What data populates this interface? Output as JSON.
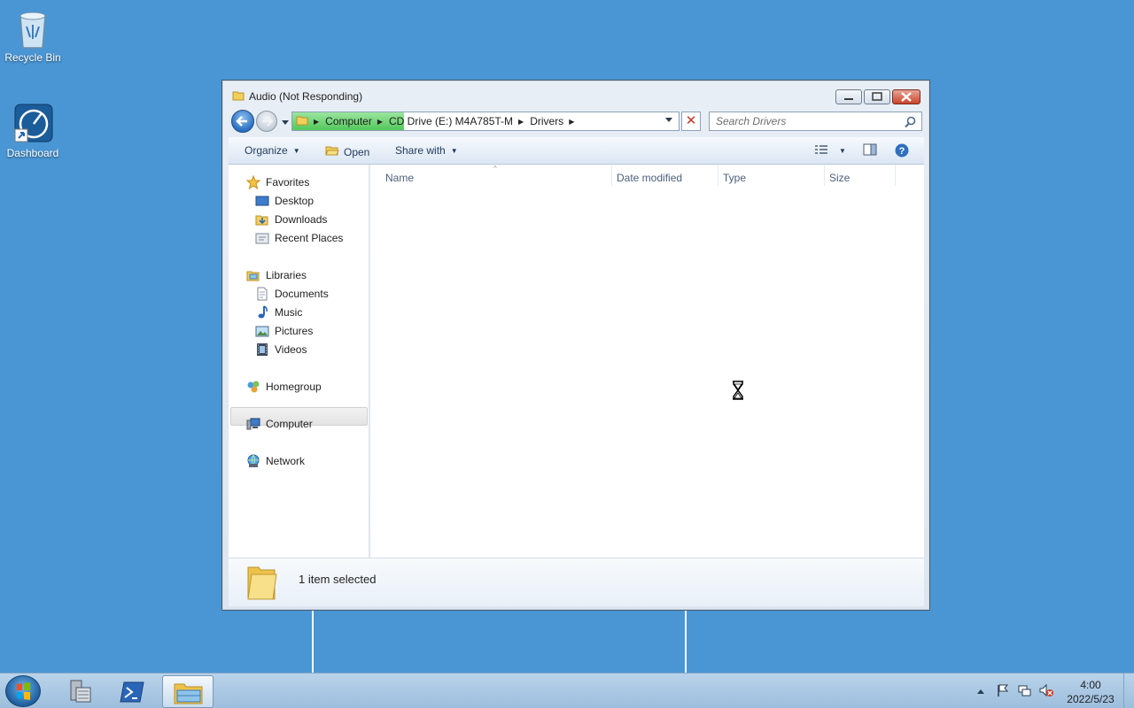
{
  "desktop": {
    "icons": [
      {
        "label": "Recycle Bin"
      },
      {
        "label": "Dashboard"
      }
    ]
  },
  "window": {
    "title": "Audio (Not Responding)",
    "address": {
      "crumbs": [
        "Computer",
        "CD Drive (E:) M4A785T-M",
        "Drivers"
      ],
      "load_progress_pct": 29
    },
    "search": {
      "placeholder": "Search Drivers"
    },
    "command_bar": {
      "organize": "Organize",
      "open": "Open",
      "share_with": "Share with"
    },
    "nav": {
      "favorites": "Favorites",
      "desktop": "Desktop",
      "downloads": "Downloads",
      "recent_places": "Recent Places",
      "libraries": "Libraries",
      "documents": "Documents",
      "music": "Music",
      "pictures": "Pictures",
      "videos": "Videos",
      "homegroup": "Homegroup",
      "computer": "Computer",
      "network": "Network"
    },
    "columns": {
      "name": "Name",
      "date_modified": "Date modified",
      "type": "Type",
      "size": "Size"
    },
    "details": {
      "status": "1 item selected"
    }
  },
  "taskbar": {
    "clock": {
      "time": "4:00",
      "date": "2022/5/23"
    }
  },
  "colors": {
    "desktop": "#4a96d4",
    "accent": "#1e395b",
    "progress": "#53c85a"
  }
}
